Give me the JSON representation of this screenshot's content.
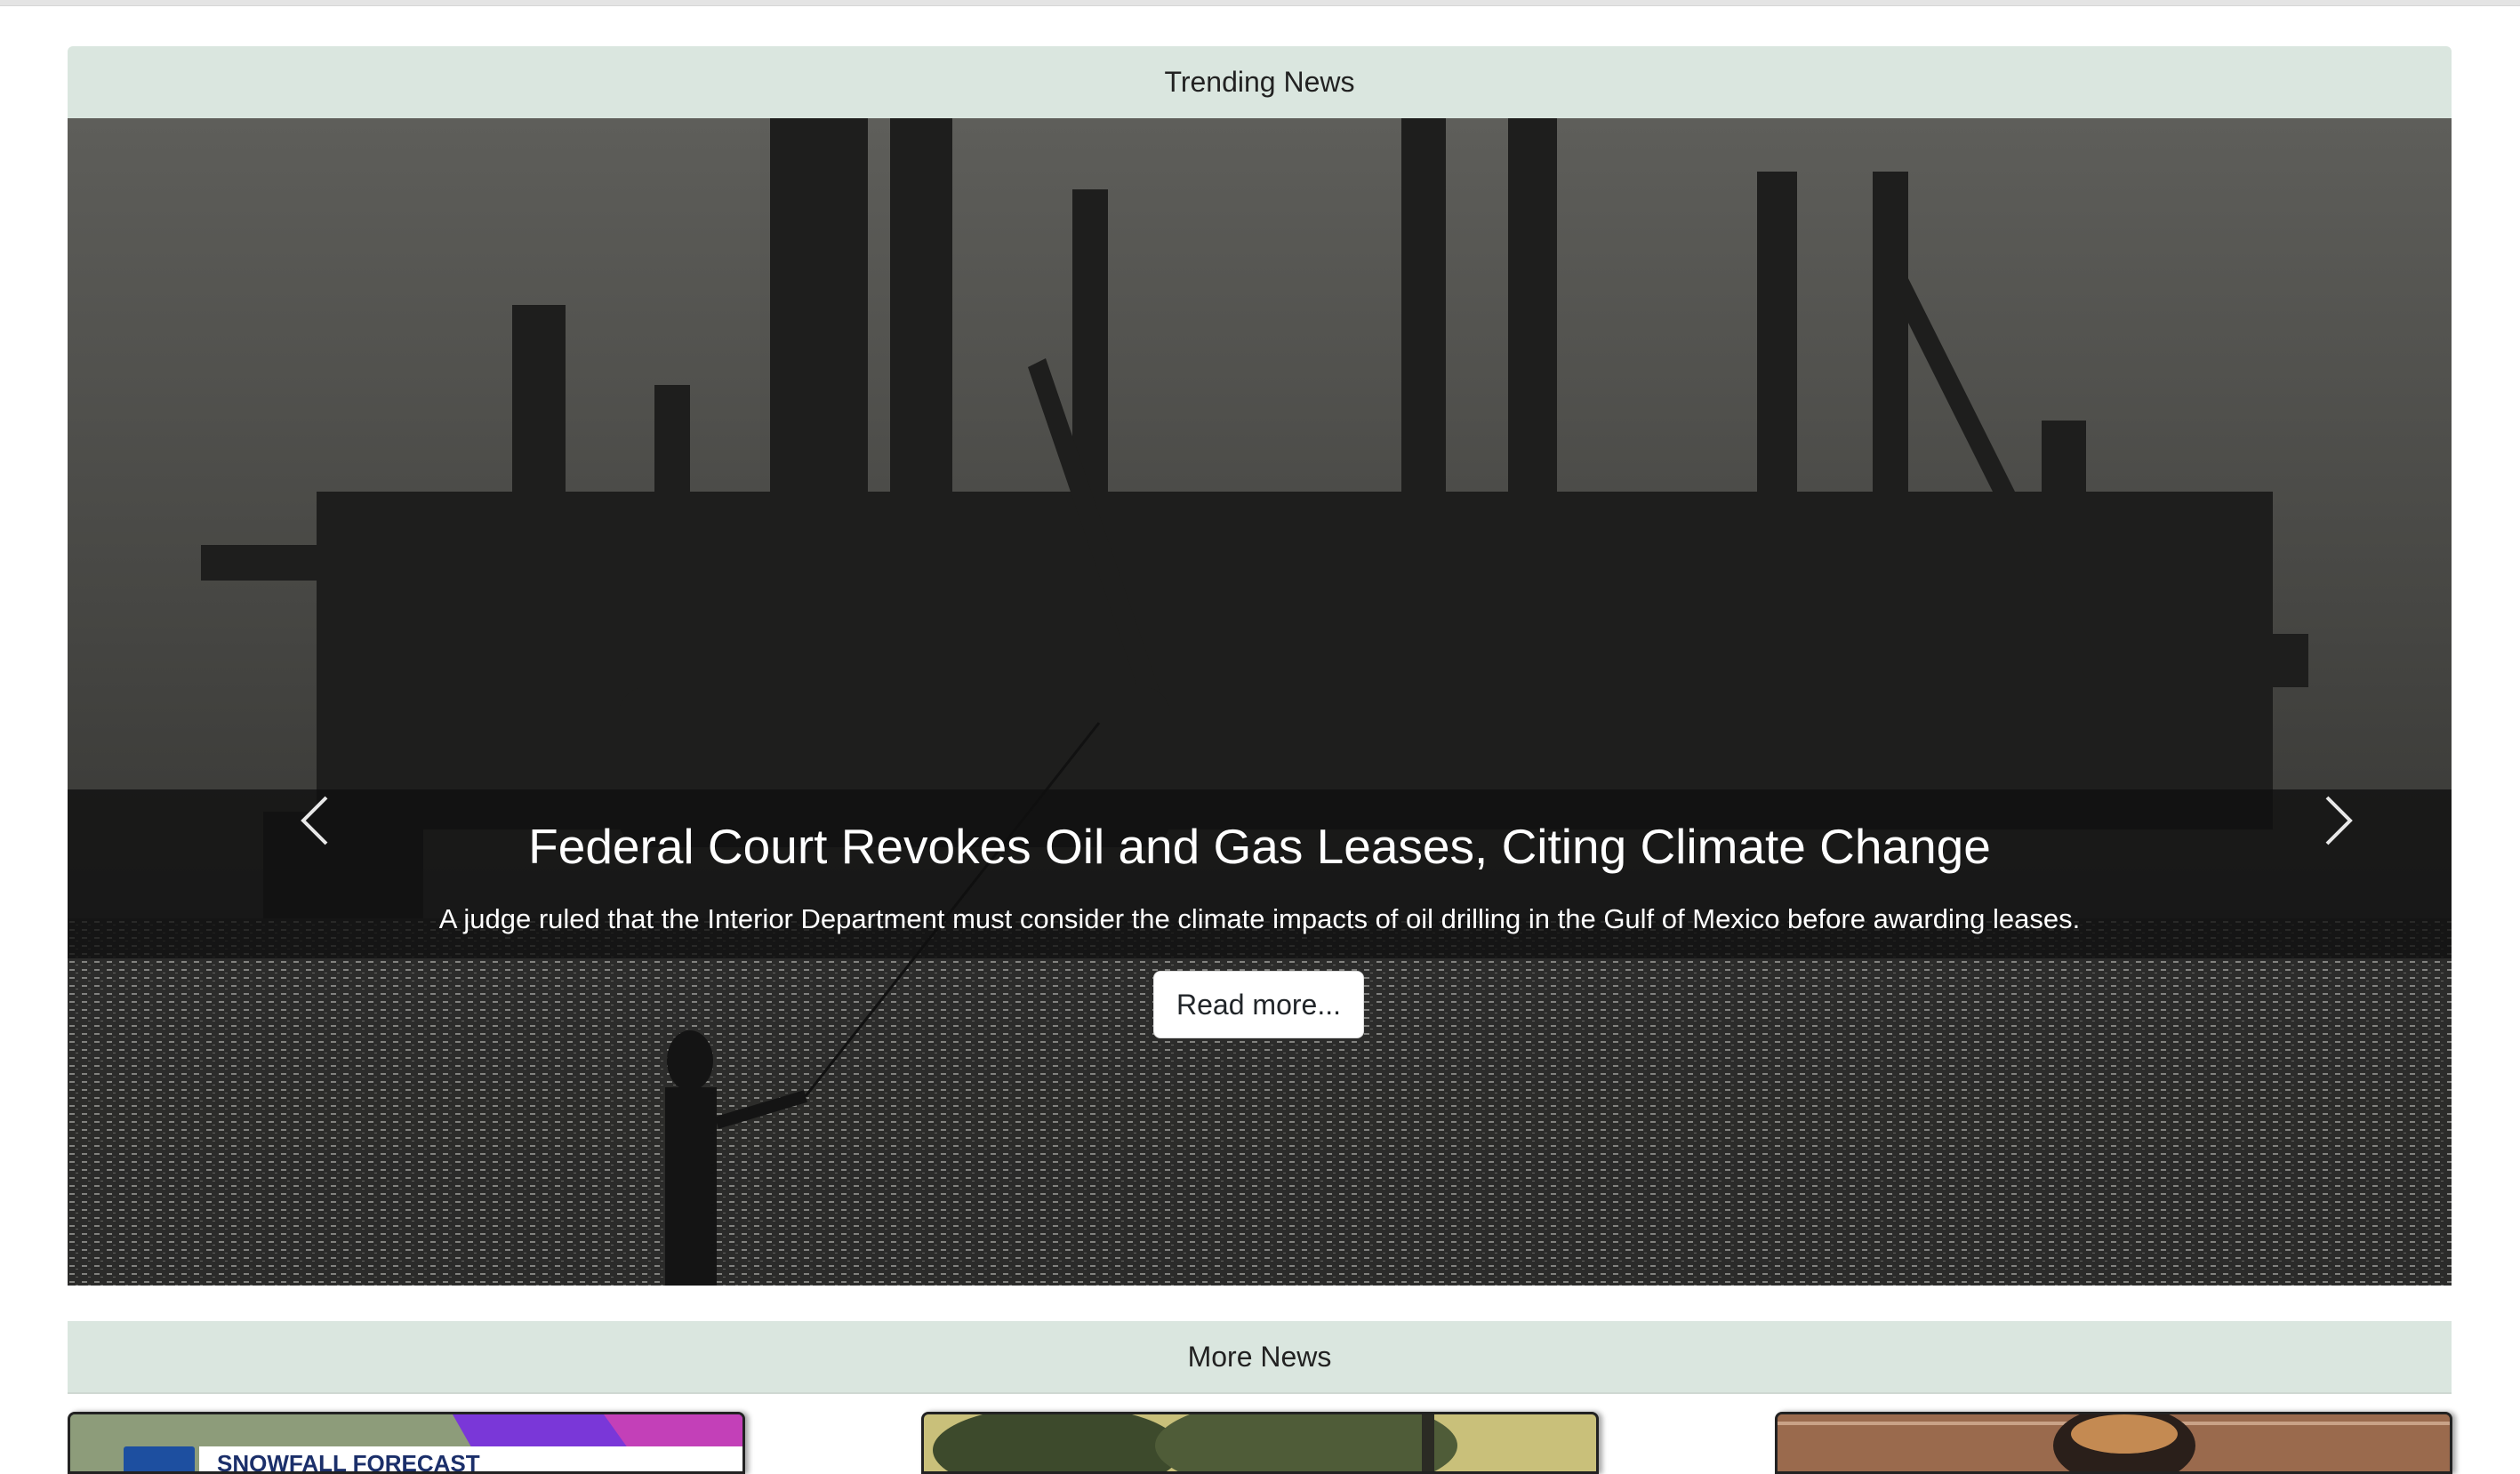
{
  "trending": {
    "header": "Trending News"
  },
  "carousel": {
    "slide": {
      "title": "Federal Court Revokes Oil and Gas Leases, Citing Climate Change",
      "text": "A judge ruled that the Interior Department must consider the climate impacts of oil drilling in the Gulf of Mexico before awarding leases.",
      "button": "Read more..."
    },
    "indicators": {
      "count": 3,
      "active": 2
    },
    "prev_icon": "chevron-left-icon",
    "next_icon": "chevron-right-icon"
  },
  "more": {
    "header": "More News",
    "cards": [
      {
        "label": "SNOWFALL FORECAST"
      },
      {
        "label": ""
      },
      {
        "label": ""
      }
    ]
  },
  "colors": {
    "section_header_bg": "#dae6df",
    "caption_band": "#0f0f0f"
  }
}
